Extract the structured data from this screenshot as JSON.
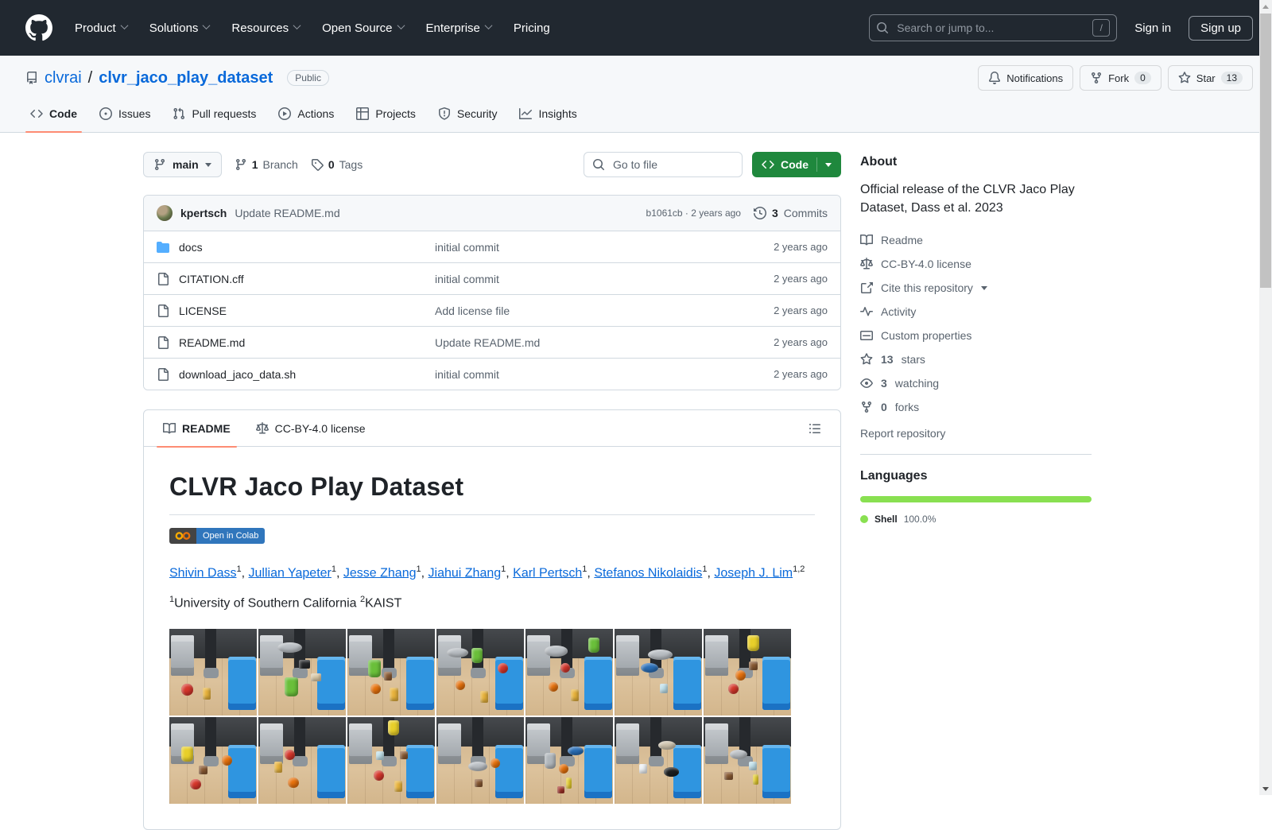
{
  "nav": {
    "items": [
      {
        "label": "Product",
        "chevron": true
      },
      {
        "label": "Solutions",
        "chevron": true
      },
      {
        "label": "Resources",
        "chevron": true
      },
      {
        "label": "Open Source",
        "chevron": true
      },
      {
        "label": "Enterprise",
        "chevron": true
      },
      {
        "label": "Pricing",
        "chevron": false
      }
    ],
    "search_placeholder": "Search or jump to...",
    "search_shortcut": "/",
    "sign_in": "Sign in",
    "sign_up": "Sign up"
  },
  "repo_header": {
    "owner": "clvrai",
    "separator": "/",
    "name": "clvr_jaco_play_dataset",
    "visibility": "Public",
    "notifications_label": "Notifications",
    "fork_label": "Fork",
    "fork_count": "0",
    "star_label": "Star",
    "star_count": "13"
  },
  "tabs": [
    {
      "label": "Code",
      "icon": "code-icon",
      "active": true
    },
    {
      "label": "Issues",
      "icon": "issue-icon",
      "active": false
    },
    {
      "label": "Pull requests",
      "icon": "pull-request-icon",
      "active": false
    },
    {
      "label": "Actions",
      "icon": "play-icon",
      "active": false
    },
    {
      "label": "Projects",
      "icon": "project-icon",
      "active": false
    },
    {
      "label": "Security",
      "icon": "shield-icon",
      "active": false
    },
    {
      "label": "Insights",
      "icon": "graph-icon",
      "active": false
    }
  ],
  "toolbar": {
    "branch": "main",
    "branch_count": "1",
    "branch_word": "Branch",
    "tag_count": "0",
    "tags_word": "Tags",
    "go_to_file_placeholder": "Go to file",
    "code_button": "Code"
  },
  "commit_bar": {
    "author": "kpertsch",
    "message": "Update README.md",
    "sha_line": "b1061cb · 2 years ago",
    "commits_count": "3",
    "commits_word": "Commits"
  },
  "files": [
    {
      "name": "docs",
      "type": "folder",
      "message": "initial commit",
      "time": "2 years ago"
    },
    {
      "name": "CITATION.cff",
      "type": "file",
      "message": "initial commit",
      "time": "2 years ago"
    },
    {
      "name": "LICENSE",
      "type": "file",
      "message": "Add license file",
      "time": "2 years ago"
    },
    {
      "name": "README.md",
      "type": "file",
      "message": "Update README.md",
      "time": "2 years ago"
    },
    {
      "name": "download_jaco_data.sh",
      "type": "file",
      "message": "initial commit",
      "time": "2 years ago"
    }
  ],
  "readme": {
    "tab_readme": "README",
    "tab_license": "CC-BY-4.0 license",
    "title": "CLVR Jaco Play Dataset",
    "colab_badge": "Open in Colab",
    "authors": [
      {
        "name": "Shivin Dass",
        "sup": "1"
      },
      {
        "name": "Jullian Yapeter",
        "sup": "1"
      },
      {
        "name": "Jesse Zhang",
        "sup": "1"
      },
      {
        "name": "Jiahui Zhang",
        "sup": "1"
      },
      {
        "name": "Karl Pertsch",
        "sup": "1"
      },
      {
        "name": "Stefanos Nikolaidis",
        "sup": "1"
      },
      {
        "name": "Joseph J. Lim",
        "sup": "1,2"
      }
    ],
    "affiliations": [
      {
        "sup": "1",
        "text": "University of Southern California "
      },
      {
        "sup": "2",
        "text": "KAIST"
      }
    ]
  },
  "sidebar": {
    "about_title": "About",
    "description": "Official release of the CLVR Jaco Play Dataset, Dass et al. 2023",
    "links": [
      {
        "icon": "book-icon",
        "label": "Readme",
        "count": "",
        "dropdown": false
      },
      {
        "icon": "law-icon",
        "label": "CC-BY-4.0 license",
        "count": "",
        "dropdown": false
      },
      {
        "icon": "cite-icon",
        "label": "Cite this repository",
        "count": "",
        "dropdown": true
      },
      {
        "icon": "pulse-icon",
        "label": "Activity",
        "count": "",
        "dropdown": false
      },
      {
        "icon": "meter-icon",
        "label": "Custom properties",
        "count": "",
        "dropdown": false
      },
      {
        "icon": "star-icon",
        "label": "stars",
        "count": "13",
        "dropdown": false
      },
      {
        "icon": "eye-icon",
        "label": "watching",
        "count": "3",
        "dropdown": false
      },
      {
        "icon": "fork-icon",
        "label": "forks",
        "count": "0",
        "dropdown": false
      }
    ],
    "report_link": "Report repository",
    "languages_title": "Languages",
    "languages": [
      {
        "name": "Shell",
        "percent": "100.0%",
        "color": "#89e051",
        "width": "100%"
      }
    ]
  },
  "colors": {
    "accent_link": "#0969da",
    "tab_underline": "#fd8c73",
    "primary_button": "#1f883d",
    "header_dark": "#212830",
    "shell_language": "#89e051"
  },
  "scenes": [
    {
      "objects": [
        [
          "ball",
          "#d6362b",
          14,
          64,
          13,
          13
        ],
        [
          "rect",
          "#e8b33c",
          38,
          68,
          9,
          14
        ]
      ]
    },
    {
      "objects": [
        [
          "plate",
          "#b9bec3",
          22,
          16,
          28,
          12
        ],
        [
          "cup",
          "#6abf3a",
          30,
          56,
          15,
          22
        ],
        [
          "rect",
          "#d9c9a8",
          60,
          52,
          12,
          9
        ],
        [
          "rect",
          "#26282b",
          46,
          36,
          13,
          10
        ]
      ]
    },
    {
      "objects": [
        [
          "cup",
          "#6abf3a",
          24,
          36,
          14,
          20
        ],
        [
          "ball",
          "#e8720c",
          26,
          64,
          12,
          12
        ],
        [
          "rect",
          "#8a5a33",
          42,
          50,
          9,
          10
        ],
        [
          "rect",
          "#e8b33c",
          48,
          68,
          10,
          16
        ]
      ]
    },
    {
      "objects": [
        [
          "plate",
          "#b9bec3",
          12,
          22,
          24,
          11
        ],
        [
          "cup",
          "#6abf3a",
          40,
          22,
          13,
          18
        ],
        [
          "ball",
          "#e8720c",
          22,
          60,
          11,
          11
        ],
        [
          "ball",
          "#d6362b",
          70,
          40,
          12,
          12
        ],
        [
          "rect",
          "#e8b33c",
          50,
          72,
          9,
          14
        ]
      ]
    },
    {
      "objects": [
        [
          "plate",
          "#b9bec3",
          22,
          20,
          26,
          12
        ],
        [
          "cup",
          "#6abf3a",
          72,
          10,
          13,
          18
        ],
        [
          "ball",
          "#d6362b",
          40,
          40,
          11,
          11
        ],
        [
          "ball",
          "#e8720c",
          26,
          62,
          11,
          11
        ],
        [
          "rect",
          "#e8b33c",
          52,
          70,
          9,
          14
        ]
      ]
    },
    {
      "objects": [
        [
          "plate",
          "#b9bec3",
          38,
          24,
          28,
          12
        ],
        [
          "plate",
          "#2a6fb8",
          30,
          40,
          20,
          11
        ],
        [
          "rect",
          "#bfe0ea",
          52,
          64,
          9,
          11
        ]
      ]
    },
    {
      "objects": [
        [
          "cup",
          "#e8cf2a",
          50,
          8,
          14,
          18
        ],
        [
          "ball",
          "#e8720c",
          36,
          48,
          12,
          12
        ],
        [
          "ball",
          "#d6362b",
          28,
          64,
          12,
          12
        ],
        [
          "rect",
          "#8a5a33",
          52,
          38,
          10,
          10
        ]
      ]
    },
    {
      "objects": [
        [
          "cup",
          "#e8cf2a",
          14,
          34,
          13,
          18
        ],
        [
          "ball",
          "#e8720c",
          60,
          44,
          12,
          12
        ],
        [
          "ball",
          "#d6362b",
          24,
          72,
          12,
          12
        ],
        [
          "rect",
          "#8a5a33",
          34,
          56,
          10,
          10
        ]
      ]
    },
    {
      "objects": [
        [
          "ball",
          "#d6362b",
          30,
          38,
          12,
          12
        ],
        [
          "ball",
          "#e8720c",
          34,
          70,
          12,
          12
        ],
        [
          "rect",
          "#e8b33c",
          18,
          52,
          9,
          13
        ]
      ]
    },
    {
      "objects": [
        [
          "cup",
          "#e8cf2a",
          46,
          4,
          13,
          17
        ],
        [
          "rect",
          "#bfe0ea",
          33,
          40,
          9,
          10
        ],
        [
          "ball",
          "#d6362b",
          30,
          62,
          12,
          12
        ],
        [
          "rect",
          "#e8b33c",
          54,
          74,
          9,
          13
        ],
        [
          "rect",
          "#8a5a33",
          60,
          40,
          9,
          9
        ]
      ]
    },
    {
      "objects": [
        [
          "plate",
          "#b9bec3",
          36,
          52,
          22,
          11
        ],
        [
          "rect",
          "#8a5a33",
          44,
          72,
          9,
          9
        ],
        [
          "ball",
          "#e8720c",
          62,
          48,
          11,
          11
        ]
      ]
    },
    {
      "objects": [
        [
          "cup",
          "#b0b6bb",
          22,
          42,
          13,
          18
        ],
        [
          "plate",
          "#2a6fb8",
          48,
          34,
          18,
          10
        ],
        [
          "ball",
          "#e8720c",
          38,
          54,
          11,
          11
        ],
        [
          "rect",
          "#e8cf2a",
          46,
          70,
          7,
          13
        ],
        [
          "rect",
          "#a33126",
          36,
          80,
          9,
          8
        ]
      ]
    },
    {
      "objects": [
        [
          "plate",
          "#cfc4ae",
          50,
          28,
          20,
          10
        ],
        [
          "plate",
          "#1c1e20",
          56,
          58,
          18,
          11
        ],
        [
          "rect",
          "#eef2f5",
          28,
          54,
          9,
          11
        ]
      ]
    },
    {
      "objects": [
        [
          "plate",
          "#b9bec3",
          30,
          38,
          20,
          11
        ],
        [
          "rect",
          "#8a5a33",
          24,
          64,
          10,
          9
        ],
        [
          "rect",
          "#e8cf2a",
          56,
          66,
          7,
          12
        ],
        [
          "rect",
          "#bfe0ea",
          52,
          52,
          9,
          10
        ]
      ]
    }
  ]
}
